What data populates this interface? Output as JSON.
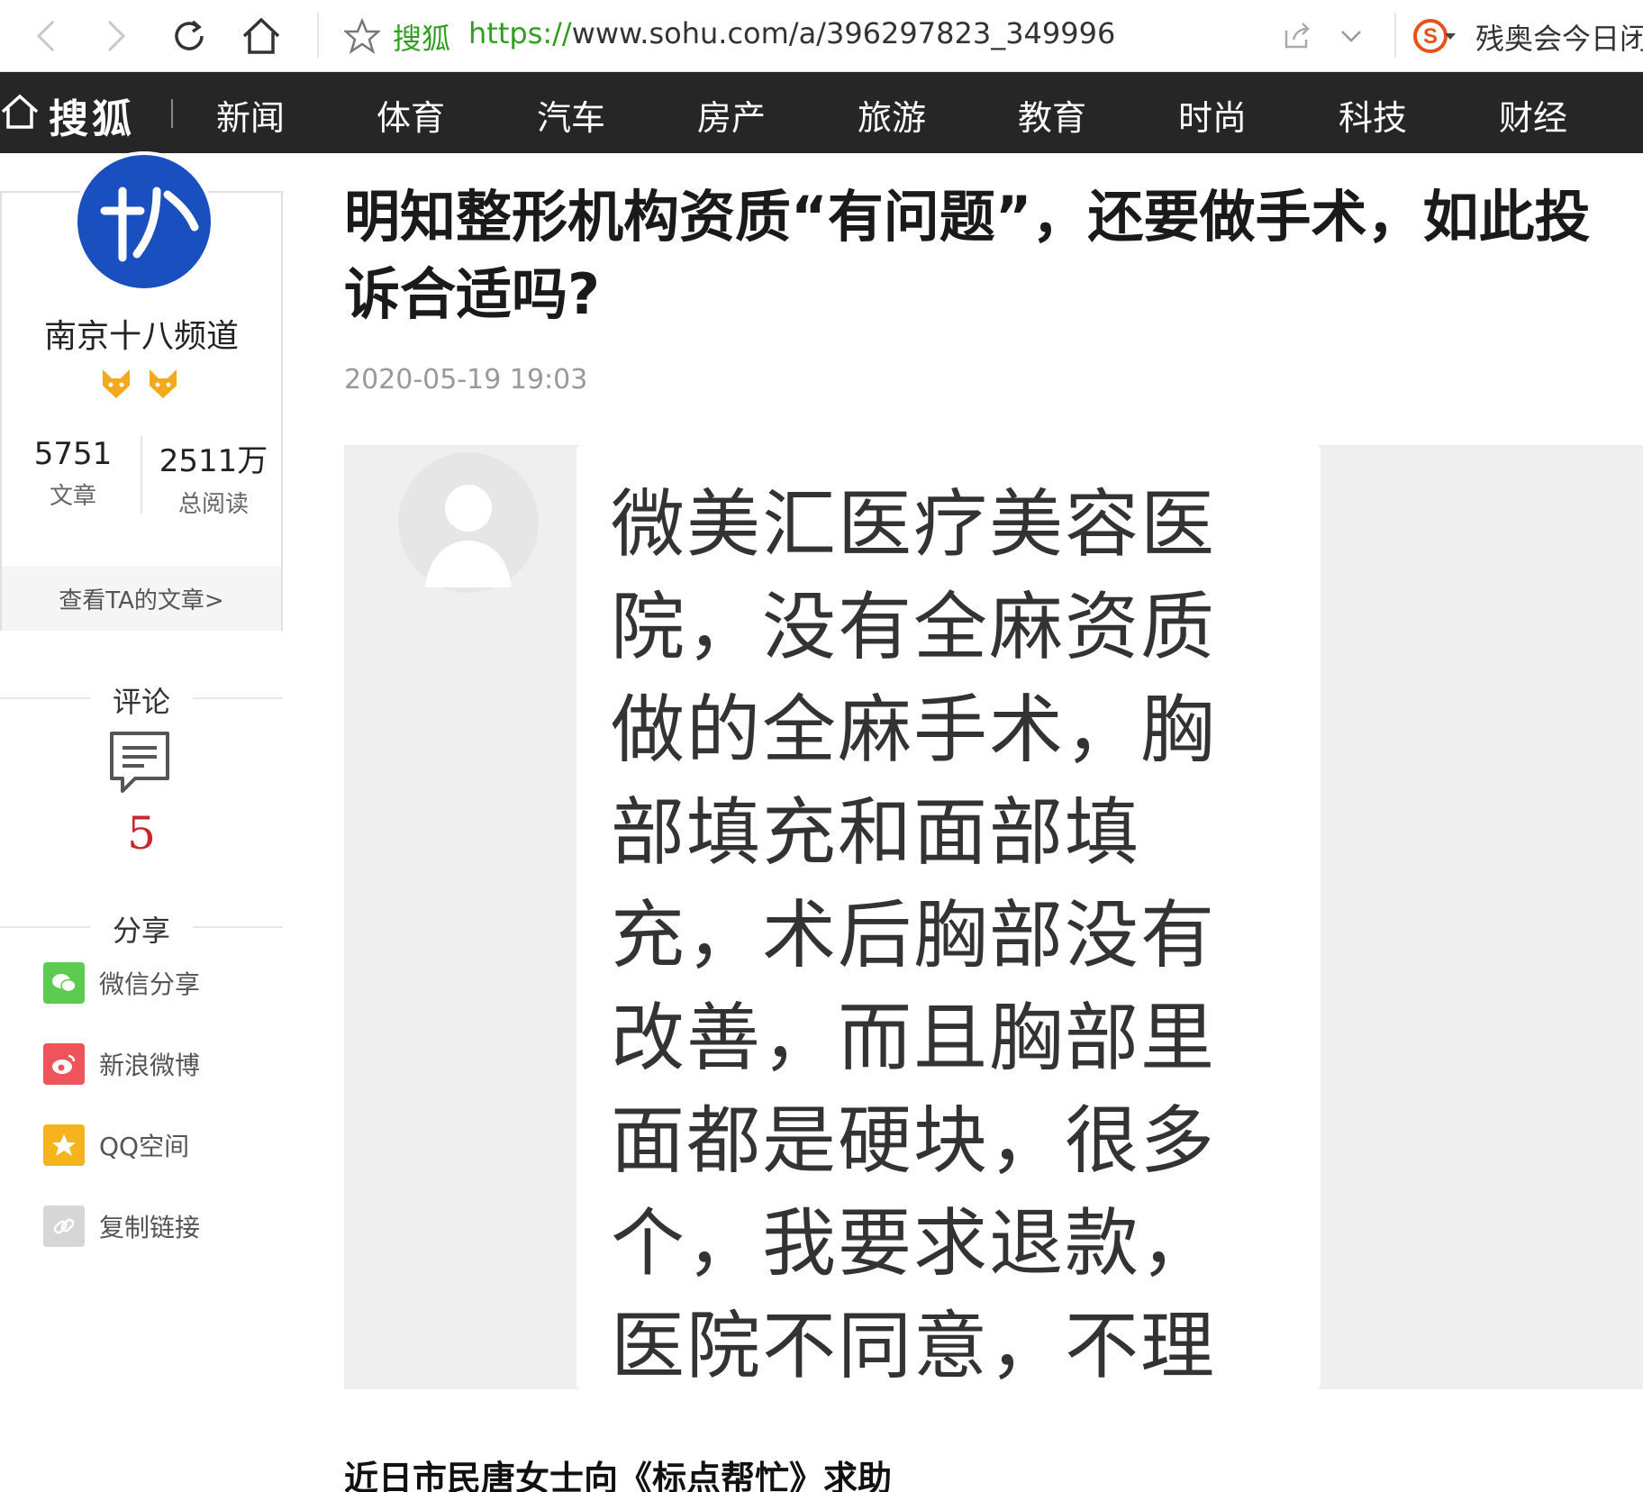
{
  "browser": {
    "site_label": "搜狐",
    "url_scheme": "https://",
    "url_rest": "www.sohu.com/a/396297823_349996",
    "news_ticker": "残奥会今日闭幕"
  },
  "sitenav": {
    "logo": "搜狐",
    "items": [
      "新闻",
      "体育",
      "汽车",
      "房产",
      "旅游",
      "教育",
      "时尚",
      "科技",
      "财经"
    ]
  },
  "author": {
    "name": "南京十八频道",
    "articles_count": "5751",
    "articles_label": "文章",
    "reads_count": "2511万",
    "reads_label": "总阅读",
    "view_articles_link": "查看TA的文章>"
  },
  "comments": {
    "heading": "评论",
    "count": "5"
  },
  "share": {
    "heading": "分享",
    "items": [
      {
        "label": "微信分享",
        "color": "#5ccb4f"
      },
      {
        "label": "新浪微博",
        "color": "#f0545b"
      },
      {
        "label": "QQ空间",
        "color": "#f5b31d"
      },
      {
        "label": "复制链接",
        "color": "#d6d6d6"
      }
    ]
  },
  "article": {
    "title": "明知整形机构资质“有问题”，还要做手术，如此投诉合适吗?",
    "date": "2020-05-19 19:03",
    "image_text": "微美汇医疗美容医院，没有全麻资质做的全麻手术，胸部填充和面部填充，术后胸部没有改善，而且胸部里面都是硬块，很多个，我要求退款，医院不同意，不理不睬",
    "lead": "近日市民唐女士向《标点帮忙》求助"
  },
  "colors": {
    "nav_bg": "#262626",
    "accent_green": "#2fa01e",
    "comment_red": "#c8282d"
  }
}
